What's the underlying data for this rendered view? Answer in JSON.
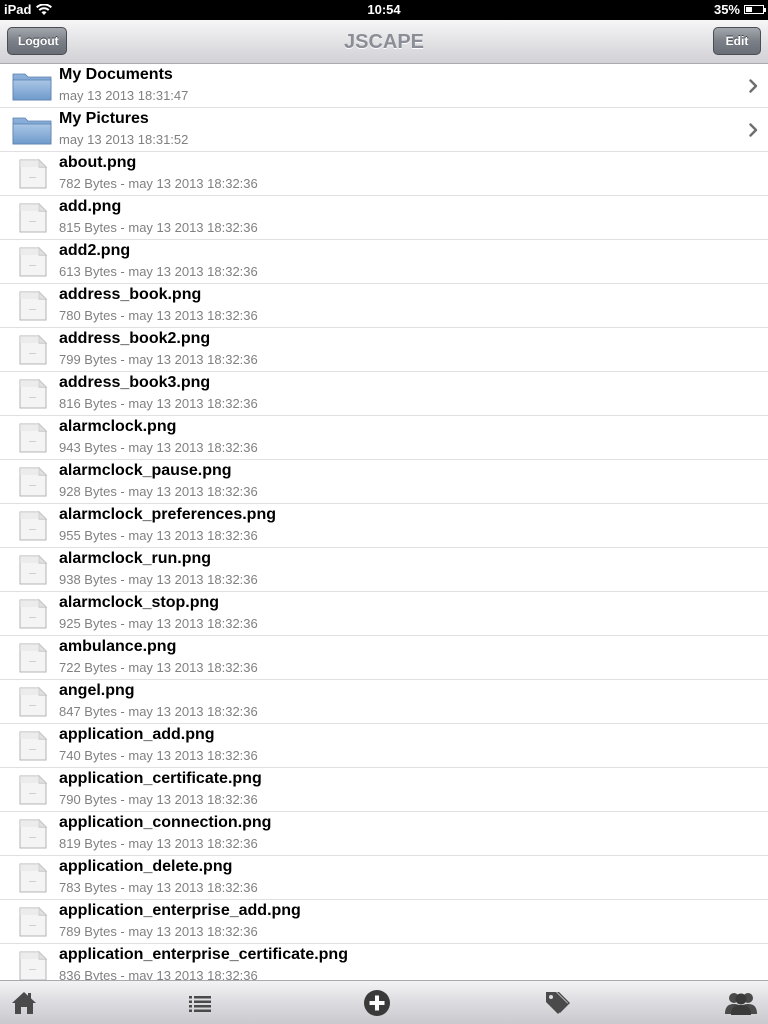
{
  "status_bar": {
    "device": "iPad",
    "time": "10:54",
    "battery": "35%",
    "battery_level": 0.35
  },
  "nav": {
    "title": "JSCAPE",
    "logout_label": "Logout",
    "edit_label": "Edit"
  },
  "folders": [
    {
      "name": "My Documents",
      "detail": "may 13 2013 18:31:47",
      "icon": "folder-icon"
    },
    {
      "name": "My Pictures",
      "detail": "may 13 2013 18:31:52",
      "icon": "folder-icon"
    }
  ],
  "files": [
    {
      "name": "about.png",
      "detail": "782 Bytes - may 13 2013 18:32:36"
    },
    {
      "name": "add.png",
      "detail": "815 Bytes - may 13 2013 18:32:36"
    },
    {
      "name": "add2.png",
      "detail": "613 Bytes - may 13 2013 18:32:36"
    },
    {
      "name": "address_book.png",
      "detail": "780 Bytes - may 13 2013 18:32:36"
    },
    {
      "name": "address_book2.png",
      "detail": "799 Bytes - may 13 2013 18:32:36"
    },
    {
      "name": "address_book3.png",
      "detail": "816 Bytes - may 13 2013 18:32:36"
    },
    {
      "name": "alarmclock.png",
      "detail": "943 Bytes - may 13 2013 18:32:36"
    },
    {
      "name": "alarmclock_pause.png",
      "detail": "928 Bytes - may 13 2013 18:32:36"
    },
    {
      "name": "alarmclock_preferences.png",
      "detail": "955 Bytes - may 13 2013 18:32:36"
    },
    {
      "name": "alarmclock_run.png",
      "detail": "938 Bytes - may 13 2013 18:32:36"
    },
    {
      "name": "alarmclock_stop.png",
      "detail": "925 Bytes - may 13 2013 18:32:36"
    },
    {
      "name": "ambulance.png",
      "detail": "722 Bytes - may 13 2013 18:32:36"
    },
    {
      "name": "angel.png",
      "detail": "847 Bytes - may 13 2013 18:32:36"
    },
    {
      "name": "application_add.png",
      "detail": "740 Bytes - may 13 2013 18:32:36"
    },
    {
      "name": "application_certificate.png",
      "detail": "790 Bytes - may 13 2013 18:32:36"
    },
    {
      "name": "application_connection.png",
      "detail": "819 Bytes - may 13 2013 18:32:36"
    },
    {
      "name": "application_delete.png",
      "detail": "783 Bytes - may 13 2013 18:32:36"
    },
    {
      "name": "application_enterprise_add.png",
      "detail": "789 Bytes - may 13 2013 18:32:36"
    },
    {
      "name": "application_enterprise_certificate.png",
      "detail": "836 Bytes - may 13 2013 18:32:36"
    }
  ],
  "tab_bar": {
    "tabs": [
      {
        "icon": "home-icon"
      },
      {
        "icon": "list-icon"
      },
      {
        "icon": "add-circle-icon"
      },
      {
        "icon": "tag-icon"
      },
      {
        "icon": "users-icon"
      }
    ]
  }
}
